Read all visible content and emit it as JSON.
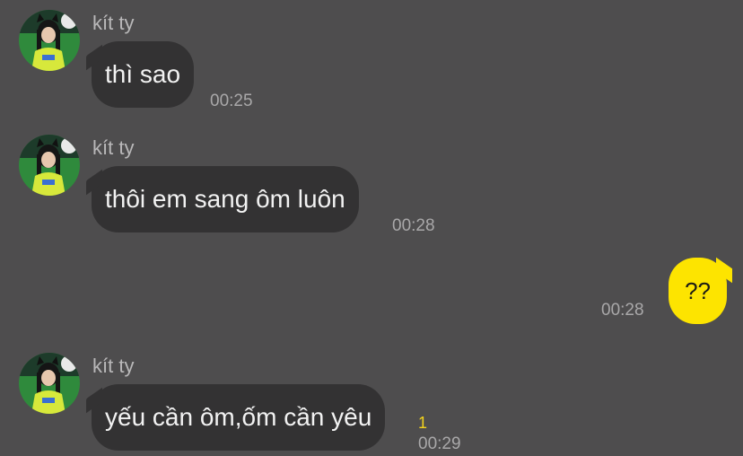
{
  "colors": {
    "background": "#4e4d4e",
    "incoming_bubble": "#333233",
    "outgoing_bubble": "#fde400",
    "unread_badge": "#f4d31c"
  },
  "messages": [
    {
      "direction": "incoming",
      "sender": "kít ty",
      "text": "thì sao",
      "time": "00:25"
    },
    {
      "direction": "incoming",
      "sender": "kít ty",
      "text": "thôi em sang ôm luôn",
      "time": "00:28"
    },
    {
      "direction": "outgoing",
      "text": "??",
      "time": "00:28"
    },
    {
      "direction": "incoming",
      "sender": "kít ty",
      "text": "yếu cần ôm,ốm cần yêu",
      "time": "00:29",
      "unread_count": "1"
    }
  ]
}
